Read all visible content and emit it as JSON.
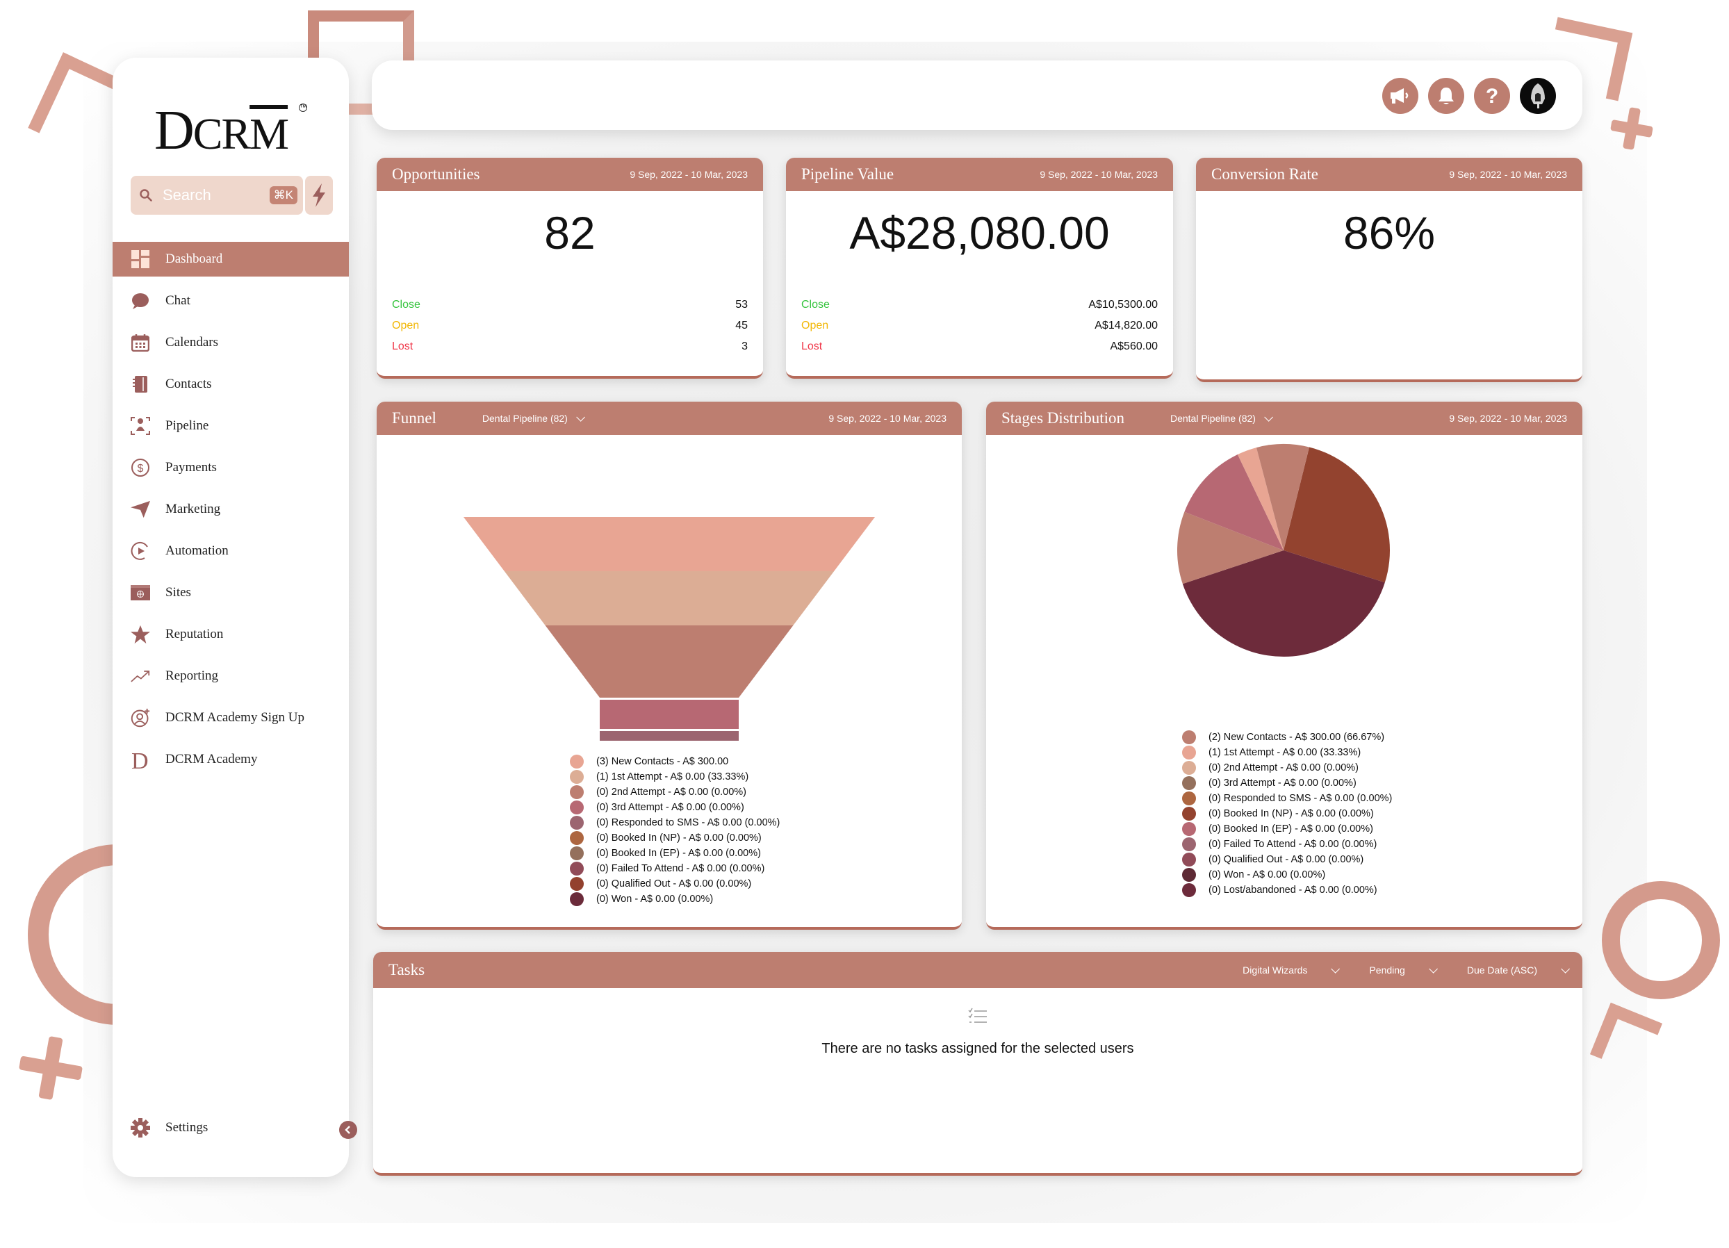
{
  "brand": {
    "logo_big": "D",
    "logo_rest_1": "C",
    "logo_rest_2": "R",
    "logo_rest_3": "M",
    "trademark": "TM"
  },
  "search": {
    "placeholder": "Search",
    "shortcut": "⌘K"
  },
  "sidebar": {
    "items": [
      {
        "label": "Dashboard",
        "icon": "dashboard-icon",
        "active": true
      },
      {
        "label": "Chat",
        "icon": "chat-icon"
      },
      {
        "label": "Calendars",
        "icon": "calendar-icon"
      },
      {
        "label": "Contacts",
        "icon": "contacts-book-icon"
      },
      {
        "label": "Pipeline",
        "icon": "pipeline-icon"
      },
      {
        "label": "Payments",
        "icon": "dollar-circle-icon"
      },
      {
        "label": "Marketing",
        "icon": "send-icon"
      },
      {
        "label": "Automation",
        "icon": "play-circle-icon"
      },
      {
        "label": "Sites",
        "icon": "globe-window-icon"
      },
      {
        "label": "Reputation",
        "icon": "star-icon"
      },
      {
        "label": "Reporting",
        "icon": "trending-up-icon"
      },
      {
        "label": "DCRM Academy Sign Up",
        "icon": "user-add-icon"
      },
      {
        "label": "DCRM Academy",
        "icon": "d-letter-icon"
      }
    ],
    "settings_label": "Settings"
  },
  "topbar": {
    "icons": [
      "megaphone-icon",
      "bell-icon",
      "help-icon",
      "user-avatar"
    ]
  },
  "colors": {
    "accent": "#bd7e70",
    "close": "#36c43e",
    "open": "#f2b705",
    "lost": "#f0384a"
  },
  "kpis": {
    "opportunities": {
      "title": "Opportunities",
      "date_range": "9 Sep, 2022 - 10 Mar, 2023",
      "value": "82",
      "rows": [
        {
          "label": "Close",
          "value": "53"
        },
        {
          "label": "Open",
          "value": "45"
        },
        {
          "label": "Lost",
          "value": "3"
        }
      ]
    },
    "pipeline_value": {
      "title": "Pipeline Value",
      "date_range": "9 Sep, 2022 - 10 Mar, 2023",
      "value": "A$28,080.00",
      "rows": [
        {
          "label": "Close",
          "value": "A$10,5300.00"
        },
        {
          "label": "Open",
          "value": "A$14,820.00"
        },
        {
          "label": "Lost",
          "value": "A$560.00"
        }
      ]
    },
    "conversion_rate": {
      "title": "Conversion Rate",
      "date_range": "9 Sep, 2022 - 10 Mar, 2023",
      "value": "86%"
    }
  },
  "funnel": {
    "title": "Funnel",
    "pipeline_select": "Dental Pipeline (82)",
    "date_range": "9 Sep, 2022 - 10 Mar, 2023"
  },
  "stages": {
    "title": "Stages Distribution",
    "pipeline_select": "Dental Pipeline (82)",
    "date_range": "9 Sep, 2022 - 10 Mar, 2023"
  },
  "tasks": {
    "title": "Tasks",
    "filters": [
      "Digital Wizards",
      "Pending",
      "Due Date (ASC)"
    ],
    "empty_message": "There are no tasks assigned for the selected users"
  },
  "chart_data": [
    {
      "type": "funnel",
      "title": "Funnel",
      "categories": [
        "New Contacts",
        "1st Attempt",
        "2nd Attempt",
        "3rd Attempt",
        "Responded to SMS",
        "Booked In (NP)",
        "Booked In (EP)",
        "Failed To Attend",
        "Qualified Out",
        "Won"
      ],
      "visible_segments": 5,
      "legend": [
        {
          "label": "(3) New Contacts - A$ 300.00",
          "color": "#e8a593"
        },
        {
          "label": "(1) 1st Attempt - A$ 0.00 (33.33%)",
          "color": "#dcad95"
        },
        {
          "label": "(0) 2nd Attempt - A$ 0.00 (0.00%)",
          "color": "#bd7e70"
        },
        {
          "label": "(0) 3rd Attempt - A$ 0.00 (0.00%)",
          "color": "#b76873"
        },
        {
          "label": "(0) Responded to SMS - A$ 0.00 (0.00%)",
          "color": "#9c6570"
        },
        {
          "label": "(0) Booked In (NP) - A$ 0.00 (0.00%)",
          "color": "#ad6640"
        },
        {
          "label": "(0) Booked In (EP) - A$ 0.00 (0.00%)",
          "color": "#94705c"
        },
        {
          "label": "(0) Failed To Attend - A$ 0.00 (0.00%)",
          "color": "#914b58"
        },
        {
          "label": "(0) Qualified Out - A$ 0.00 (0.00%)",
          "color": "#93412e"
        },
        {
          "label": "(0) Won - A$ 0.00 (0.00%)",
          "color": "#6b2b3a"
        }
      ]
    },
    {
      "type": "pie",
      "title": "Stages Distribution",
      "slices": [
        {
          "name": "Qualified Out",
          "value": 26,
          "color": "#93432f"
        },
        {
          "name": "Lost/abandoned",
          "value": 40,
          "color": "#6d2b3b"
        },
        {
          "name": "New Contacts",
          "value": 11,
          "color": "#bd7e70"
        },
        {
          "name": "Booked In (EP)",
          "value": 12,
          "color": "#b76873"
        },
        {
          "name": "1st Attempt",
          "value": 3,
          "color": "#e8a593"
        },
        {
          "name": "2nd Attempt",
          "value": 8,
          "color": "#bd7e70"
        }
      ],
      "legend": [
        {
          "label": "(2) New Contacts - A$ 300.00 (66.67%)",
          "color": "#bd7e70"
        },
        {
          "label": "(1) 1st Attempt - A$ 0.00 (33.33%)",
          "color": "#e8a593"
        },
        {
          "label": "(0) 2nd Attempt - A$ 0.00 (0.00%)",
          "color": "#dcad95"
        },
        {
          "label": "(0) 3rd Attempt - A$ 0.00 (0.00%)",
          "color": "#94705c"
        },
        {
          "label": "(0) Responded to SMS - A$ 0.00 (0.00%)",
          "color": "#ad6640"
        },
        {
          "label": "(0) Booked In (NP) - A$ 0.00 (0.00%)",
          "color": "#93432f"
        },
        {
          "label": "(0) Booked In (EP) - A$ 0.00 (0.00%)",
          "color": "#b76873"
        },
        {
          "label": "(0) Failed To Attend - A$ 0.00 (0.00%)",
          "color": "#9c6570"
        },
        {
          "label": "(0) Qualified Out - A$ 0.00 (0.00%)",
          "color": "#914b58"
        },
        {
          "label": "(0) Won - A$ 0.00 (0.00%)",
          "color": "#5e2a35"
        },
        {
          "label": "(0) Lost/abandoned - A$ 0.00 (0.00%)",
          "color": "#6d2b3b"
        }
      ]
    }
  ]
}
